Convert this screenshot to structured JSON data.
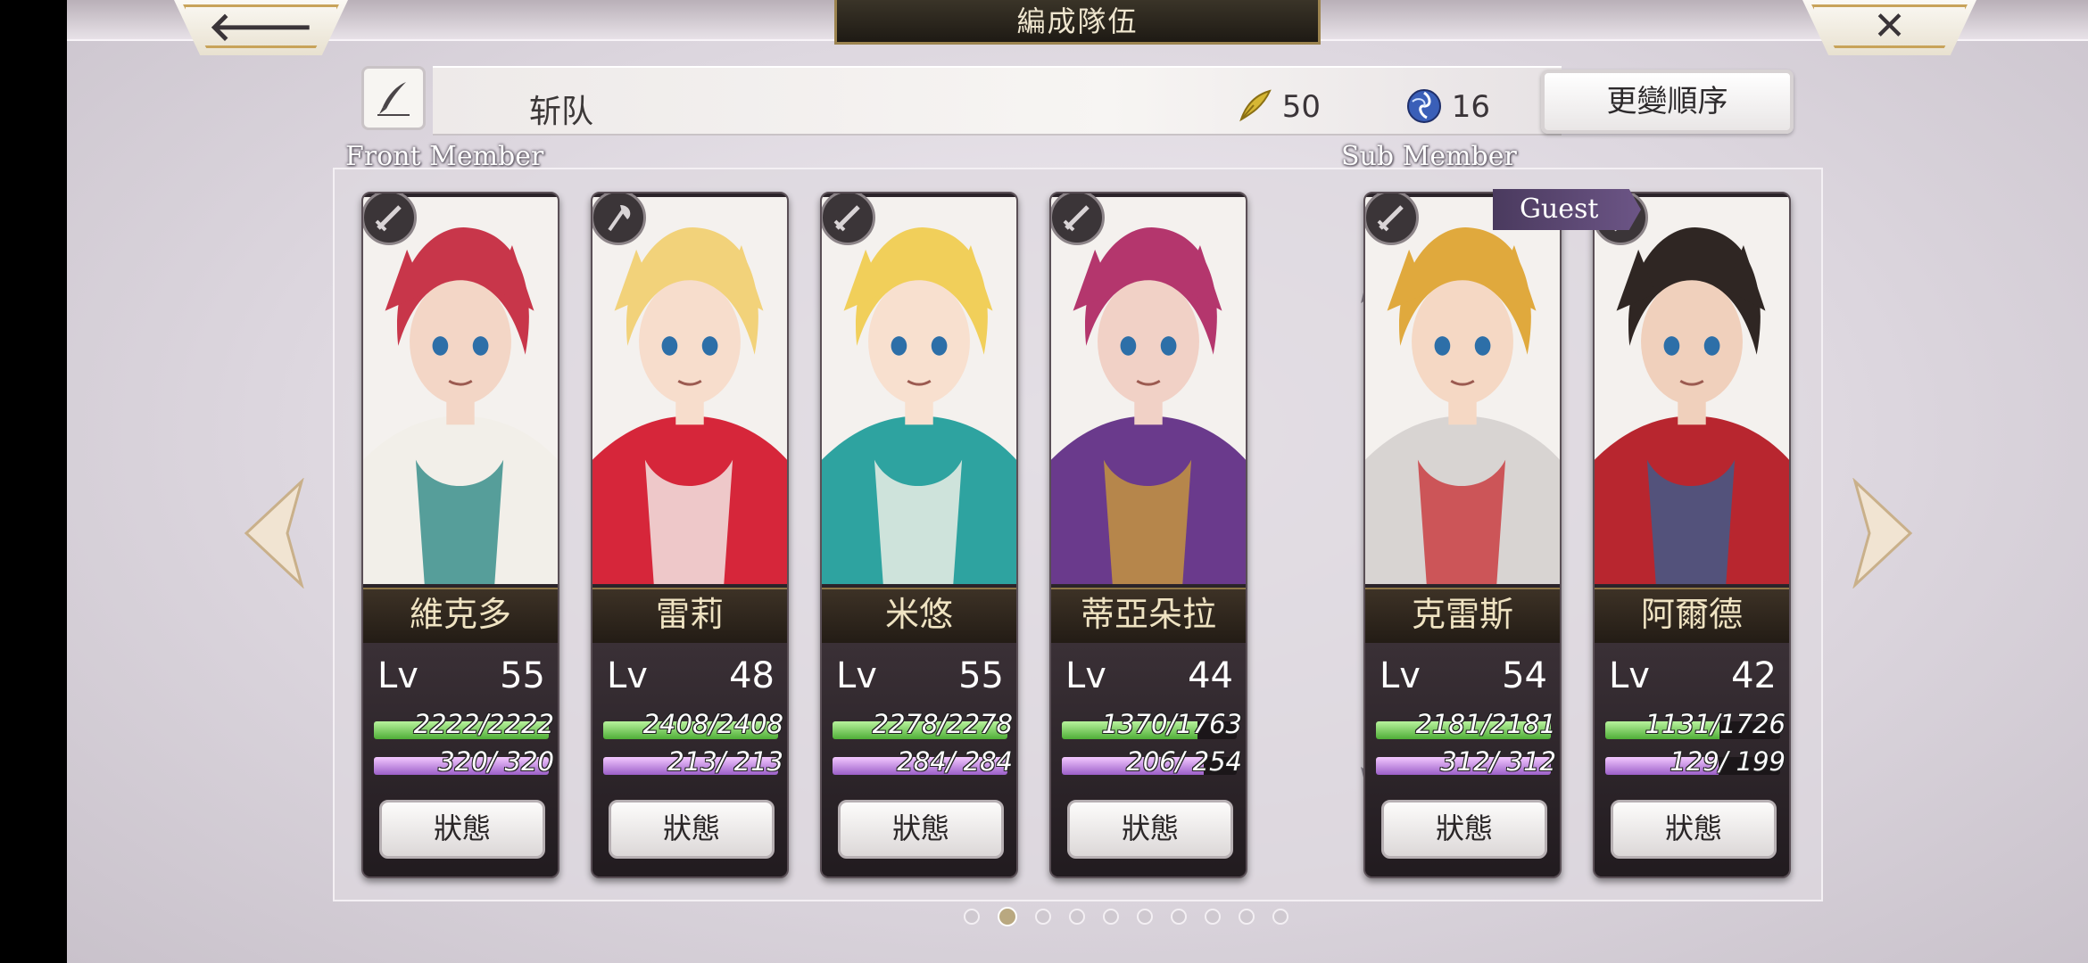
{
  "header": {
    "title": "編成隊伍",
    "back_icon": "left-arrow-icon",
    "close_icon": "close-icon"
  },
  "party": {
    "name": "斩队",
    "edit_icon": "quill-pen-icon",
    "feather_value": "50",
    "orb_value": "16",
    "order_button": "更變順序"
  },
  "labels": {
    "front": "Front Member",
    "sub": "Sub Member",
    "guest": "Guest",
    "lv": "Lv"
  },
  "members": [
    {
      "name": "維克多",
      "lv": "55",
      "hp": "2222/2222",
      "mp": "320/ 320",
      "hp_ratio": 1.0,
      "mp_ratio": 1.0,
      "weapon": "sword-icon",
      "hair": "#c8364a",
      "skin": "#f3d6c6",
      "outfit": "#f2efe9",
      "accent": "#2e8a86"
    },
    {
      "name": "雷莉",
      "lv": "48",
      "hp": "2408/2408",
      "mp": "213/ 213",
      "hp_ratio": 1.0,
      "mp_ratio": 1.0,
      "weapon": "axe-icon",
      "hair": "#f2d27a",
      "skin": "#f7ddcc",
      "outfit": "#d6263a",
      "accent": "#f4f1ee"
    },
    {
      "name": "米悠",
      "lv": "55",
      "hp": "2278/2278",
      "mp": "284/ 284",
      "hp_ratio": 1.0,
      "mp_ratio": 1.0,
      "weapon": "sword-icon",
      "hair": "#f1cf5a",
      "skin": "#f8e0cf",
      "outfit": "#2ea3a0",
      "accent": "#f6f2ea"
    },
    {
      "name": "蒂亞朵拉",
      "lv": "44",
      "hp": "1370/1763",
      "mp": "206/ 254",
      "hp_ratio": 0.777,
      "mp_ratio": 0.811,
      "weapon": "sword-icon",
      "hair": "#b4366d",
      "skin": "#f1d1c6",
      "outfit": "#6a3a8c",
      "accent": "#c99a3b"
    },
    {
      "name": "克雷斯",
      "lv": "54",
      "hp": "2181/2181",
      "mp": "312/ 312",
      "hp_ratio": 1.0,
      "mp_ratio": 1.0,
      "weapon": "sword-icon",
      "hair": "#e0a93d",
      "skin": "#f5d8c4",
      "outfit": "#d8d4d2",
      "accent": "#c9353a"
    },
    {
      "name": "阿爾德",
      "lv": "42",
      "hp": "1131/1726",
      "mp": "129/ 199",
      "hp_ratio": 0.655,
      "mp_ratio": 0.648,
      "weapon": "sword-icon",
      "hair": "#2f2623",
      "skin": "#f0d0bc",
      "outfit": "#b8262f",
      "accent": "#3a5e8e"
    }
  ],
  "buttons": {
    "status": "狀態"
  },
  "pagination": {
    "count": 10,
    "active": 1
  },
  "colors": {
    "gold_trim": "#c8a35a",
    "hp": "#4fae37",
    "mp": "#9b5fc8",
    "guest": "#5a4672"
  }
}
